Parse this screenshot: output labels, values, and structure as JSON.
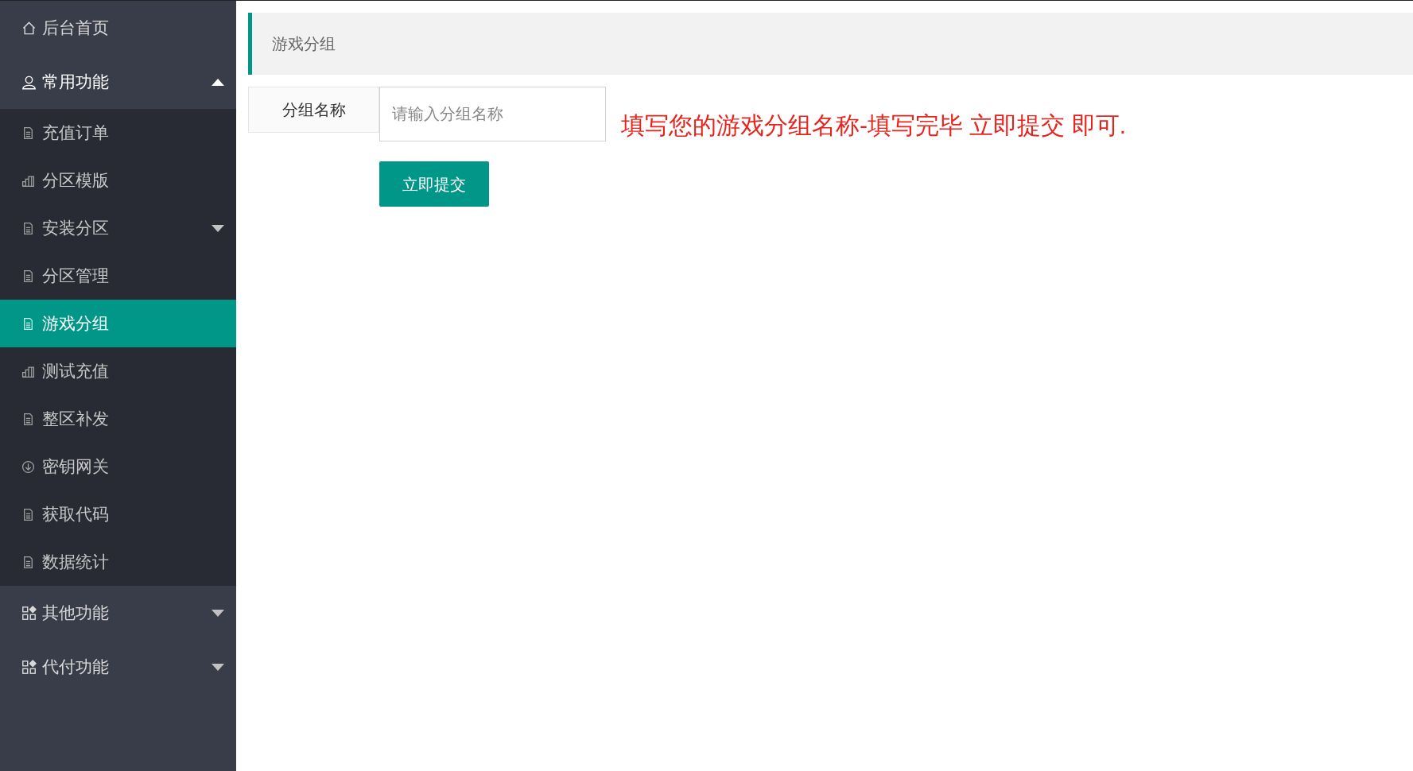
{
  "sidebar": {
    "items": [
      {
        "label": "后台首页",
        "kind": "home"
      },
      {
        "label": "常用功能",
        "kind": "user",
        "expanded": true,
        "children": [
          {
            "label": "充值订单",
            "kind": "doc",
            "selected": false
          },
          {
            "label": "分区模版",
            "kind": "bars",
            "selected": false
          },
          {
            "label": "安装分区",
            "kind": "doc",
            "selected": false,
            "expanded": false
          },
          {
            "label": "分区管理",
            "kind": "doc",
            "selected": false
          },
          {
            "label": "游戏分组",
            "kind": "doc",
            "selected": true
          },
          {
            "label": "测试充值",
            "kind": "bars",
            "selected": false
          },
          {
            "label": "整区补发",
            "kind": "doc",
            "selected": false
          },
          {
            "label": "密钥网关",
            "kind": "download",
            "selected": false
          },
          {
            "label": "获取代码",
            "kind": "doc",
            "selected": false
          },
          {
            "label": "数据统计",
            "kind": "doc",
            "selected": false
          }
        ]
      },
      {
        "label": "其他功能",
        "kind": "apps",
        "expanded": false
      },
      {
        "label": "代付功能",
        "kind": "apps",
        "expanded": false
      }
    ]
  },
  "page_title": "游戏分组",
  "form": {
    "label": "分组名称",
    "placeholder": "请输入分组名称",
    "hint": "填写您的游戏分组名称-填写完毕 立即提交 即可.",
    "submit": "立即提交"
  }
}
